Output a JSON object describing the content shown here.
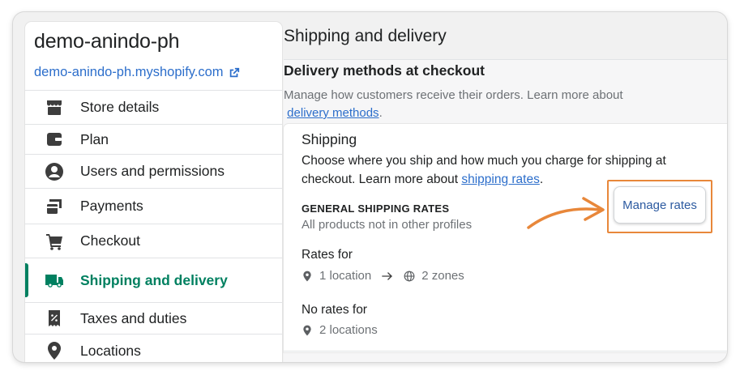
{
  "store": {
    "name": "demo-anindo-ph",
    "url": "demo-anindo-ph.myshopify.com"
  },
  "sidebar": {
    "items": [
      {
        "label": "Store details",
        "icon": "store-icon"
      },
      {
        "label": "Plan",
        "icon": "wallet-icon"
      },
      {
        "label": "Users and permissions",
        "icon": "user-icon"
      },
      {
        "label": "Payments",
        "icon": "credit-card-icon"
      },
      {
        "label": "Checkout",
        "icon": "cart-icon"
      },
      {
        "label": "Shipping and delivery",
        "icon": "truck-icon",
        "active": true
      },
      {
        "label": "Taxes and duties",
        "icon": "receipt-percent-icon"
      },
      {
        "label": "Locations",
        "icon": "location-pin-icon"
      }
    ]
  },
  "main": {
    "page_title": "Shipping and delivery",
    "section": {
      "title": "Delivery methods at checkout",
      "desc": "Manage how customers receive their orders. Learn more about",
      "link": "delivery methods"
    },
    "shipping": {
      "title": "Shipping",
      "desc": "Choose where you ship and how much you charge for shipping at checkout. Learn more about",
      "link": "shipping rates",
      "general_title": "GENERAL SHIPPING RATES",
      "general_sub": "All products not in other profiles",
      "rates_for": "Rates for",
      "locations": "1 location",
      "zones": "2 zones",
      "no_rates_for": "No rates for",
      "no_rates_locations": "2 locations",
      "manage_button": "Manage rates"
    }
  },
  "colors": {
    "accent": "#008060",
    "link": "#2c6ecb",
    "highlight": "#e8873a"
  }
}
